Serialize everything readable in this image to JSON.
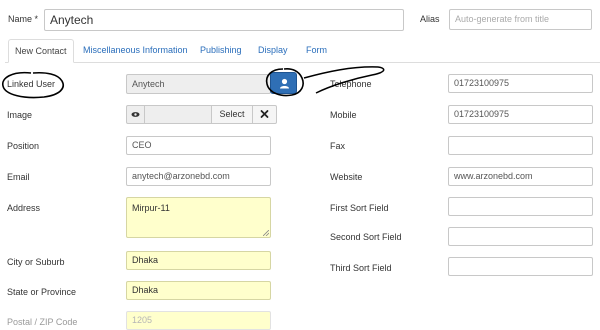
{
  "header": {
    "name_label": "Name *",
    "name_value": "Anytech",
    "alias_label": "Alias",
    "alias_placeholder": "Auto-generate from title"
  },
  "tabs": [
    {
      "label": "New Contact",
      "active": true
    },
    {
      "label": "Miscellaneous Information",
      "active": false
    },
    {
      "label": "Publishing",
      "active": false
    },
    {
      "label": "Display",
      "active": false
    },
    {
      "label": "Form",
      "active": false
    }
  ],
  "left": {
    "linked_user": {
      "label": "Linked User",
      "value": "Anytech"
    },
    "image": {
      "label": "Image",
      "select_label": "Select",
      "clear_icon": "times-icon",
      "preview_icon": "eye-icon"
    },
    "position": {
      "label": "Position",
      "value": "CEO"
    },
    "email": {
      "label": "Email",
      "value": "anytech@arzonebd.com"
    },
    "address": {
      "label": "Address",
      "value": "Mirpur-11"
    },
    "city": {
      "label": "City or Suburb",
      "value": "Dhaka"
    },
    "state": {
      "label": "State or Province",
      "value": "Dhaka"
    },
    "postal": {
      "label": "Postal / ZIP Code",
      "value": "1205"
    }
  },
  "right": {
    "telephone": {
      "label": "Telephone",
      "value": "01723100975"
    },
    "mobile": {
      "label": "Mobile",
      "value": "01723100975"
    },
    "fax": {
      "label": "Fax",
      "value": ""
    },
    "website": {
      "label": "Website",
      "value": "www.arzonebd.com"
    },
    "first_sort": {
      "label": "First Sort Field",
      "value": ""
    },
    "second_sort": {
      "label": "Second Sort Field",
      "value": ""
    },
    "third_sort": {
      "label": "Third Sort Field",
      "value": ""
    }
  },
  "colors": {
    "accent": "#2f6fb5",
    "link": "#2a6ebb",
    "required_field": "#ffffcc",
    "annotation": "#000000"
  },
  "icons": {
    "user_button": "user-icon"
  }
}
